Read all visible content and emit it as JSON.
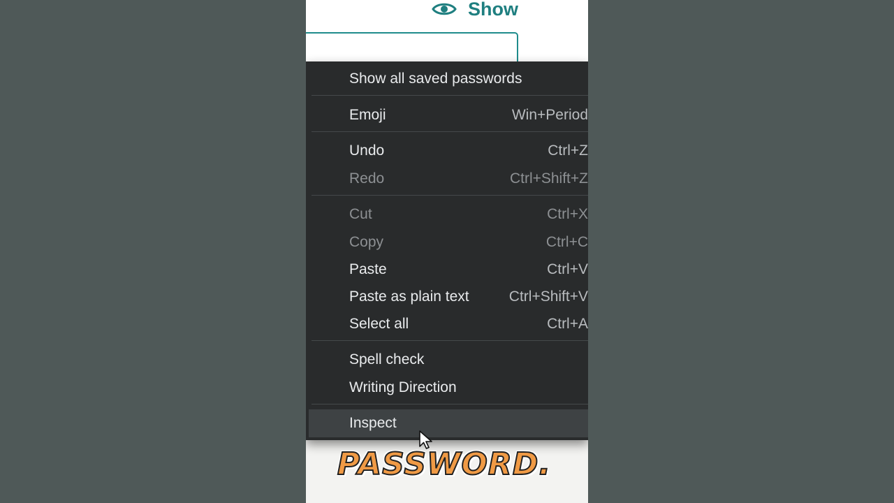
{
  "page": {
    "show_toggle": {
      "icon": "eye-icon",
      "label": "Show",
      "color": "#1f7f80"
    }
  },
  "context_menu": {
    "items": [
      {
        "label": "Show all saved passwords",
        "shortcut": "",
        "disabled": false
      },
      {
        "label": "Emoji",
        "shortcut": "Win+Period",
        "disabled": false
      },
      {
        "label": "Undo",
        "shortcut": "Ctrl+Z",
        "disabled": false
      },
      {
        "label": "Redo",
        "shortcut": "Ctrl+Shift+Z",
        "disabled": true
      },
      {
        "label": "Cut",
        "shortcut": "Ctrl+X",
        "disabled": true
      },
      {
        "label": "Copy",
        "shortcut": "Ctrl+C",
        "disabled": true
      },
      {
        "label": "Paste",
        "shortcut": "Ctrl+V",
        "disabled": false
      },
      {
        "label": "Paste as plain text",
        "shortcut": "Ctrl+Shift+V",
        "disabled": false
      },
      {
        "label": "Select all",
        "shortcut": "Ctrl+A",
        "disabled": false
      },
      {
        "label": "Spell check",
        "shortcut": "",
        "disabled": false
      },
      {
        "label": "Writing Direction",
        "shortcut": "",
        "disabled": false
      },
      {
        "label": "Inspect",
        "shortcut": "",
        "disabled": false,
        "hovered": true
      }
    ],
    "background_color": "#292b2c"
  },
  "caption": {
    "text": "PASSWORD.",
    "color": "#f09a45"
  }
}
